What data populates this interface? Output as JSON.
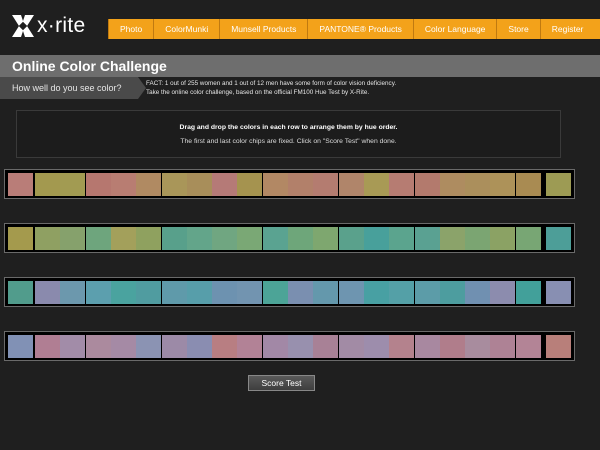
{
  "header": {
    "logo_text": "x·rite",
    "nav": [
      "Photo",
      "ColorMunki",
      "Munsell Products",
      "PANTONE® Products",
      "Color Language",
      "Store",
      "Register"
    ]
  },
  "page": {
    "title": "Online Color Challenge",
    "subtitle": "How well do you see color?",
    "fact_line1": "FACT: 1 out of 255 women and 1 out of 12 men have some form of color vision deficiency.",
    "fact_line2": "Take the online color challenge, based on the official FM100 Hue Test by X-Rite."
  },
  "instructions": {
    "line1": "Drag and drop the colors in each row to arrange them by hue order.",
    "line2": "The first and last color chips are fixed. Click on \"Score Test\" when done."
  },
  "colors": {
    "nav_bg": "#f3a21a",
    "title_bg": "#6e6e6e",
    "page_bg": "#1f1f1f"
  },
  "rows": [
    [
      "#b97d78",
      "#a3994f",
      "#a29b52",
      "#b6776f",
      "#b87d72",
      "#b08a62",
      "#a99659",
      "#a88e5a",
      "#b57a77",
      "#a5934f",
      "#b28864",
      "#b2806a",
      "#b47c70",
      "#b0856a",
      "#a89a55",
      "#b67c72",
      "#b37a6d",
      "#ae8c60",
      "#ab8f5c",
      "#ad9259",
      "#a98b52",
      "#9d9b54"
    ],
    [
      "#a49a4d",
      "#8fa062",
      "#86a16c",
      "#6ea57d",
      "#a3a05b",
      "#8fa15f",
      "#58a08b",
      "#63a58a",
      "#70a681",
      "#7aa875",
      "#5aa391",
      "#6ea67a",
      "#7ea76f",
      "#5aa18c",
      "#48a09b",
      "#5ba48e",
      "#5aa192",
      "#8ba36a",
      "#7ba572",
      "#8ba264",
      "#78a674",
      "#4d9e98"
    ],
    [
      "#519c8c",
      "#8a8aad",
      "#6c98ad",
      "#5c9fae",
      "#4aa39f",
      "#509ca0",
      "#5f9aaa",
      "#579eaa",
      "#6d92b0",
      "#7294b0",
      "#4ca497",
      "#7a8fb0",
      "#6498ac",
      "#6e95b0",
      "#48a0a3",
      "#54a0a7",
      "#5c9ca8",
      "#4d9d9f",
      "#7090b1",
      "#8c8cae",
      "#42a09a",
      "#888fb2"
    ],
    [
      "#8191b5",
      "#b07e93",
      "#a28ca8",
      "#ab8a9e",
      "#a58aa5",
      "#8b93b3",
      "#9c8aa7",
      "#8a8db1",
      "#b87e82",
      "#b28296",
      "#a288a6",
      "#9890ae",
      "#a88196",
      "#a28ba5",
      "#9d8dac",
      "#b4828d",
      "#a888a0",
      "#b07d8b",
      "#a88c9e",
      "#ae8295",
      "#b38496",
      "#b87f7a"
    ]
  ],
  "button": {
    "score_label": "Score Test"
  }
}
